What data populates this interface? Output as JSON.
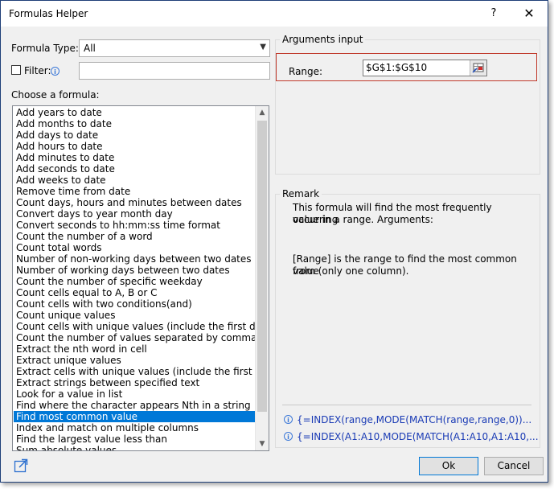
{
  "window": {
    "title": "Formulas Helper",
    "help_glyph": "?",
    "close_glyph": "✕"
  },
  "left": {
    "formula_type_label": "Formula Type:",
    "formula_type_value": "All",
    "filter_label": "Filter:",
    "filter_value": "",
    "choose_label": "Choose a formula:",
    "formulas": [
      "Add years to date",
      "Add months to date",
      "Add days to date",
      "Add hours to date",
      "Add minutes to date",
      "Add seconds to date",
      "Add weeks to date",
      "Remove time from date",
      "Count days, hours and minutes between dates",
      "Convert days to year month day",
      "Convert seconds to hh:mm:ss time format",
      "Count the number of a word",
      "Count total words",
      "Number of non-working days between two dates",
      "Number of working days between two dates",
      "Count the number of specific weekday",
      "Count cells equal to A, B or C",
      "Count cells with two conditions(and)",
      "Count unique values",
      "Count cells with unique values (include the first duplica",
      "Count the number of values separated by comma",
      "Extract the nth word in cell",
      "Extract unique values",
      "Extract cells with unique values (include the first duplic",
      "Extract strings between specified text",
      "Look for a value in list",
      "Find where the character appears Nth in a string",
      "Find most common value",
      "Index and match on multiple columns",
      "Find the largest value less than",
      "Sum absolute values"
    ],
    "selected_index": 27
  },
  "arguments": {
    "title": "Arguments input",
    "range_label": "Range:",
    "range_value": "$G$1:$G$10"
  },
  "remark": {
    "title": "Remark",
    "line1": "This formula will find the most frequently occurring",
    "line2": "value in a range. Arguments:",
    "line3": "[Range] is the range to find the most common value",
    "line4": "from (only one column).",
    "formula1": "{=INDEX(range,MODE(MATCH(range,range,0))...",
    "formula2": "{=INDEX(A1:A10,MODE(MATCH(A1:A10,A1:A10,..."
  },
  "buttons": {
    "ok": "Ok",
    "cancel": "Cancel"
  },
  "colors": {
    "selection": "#0078d7",
    "accent_border": "#c0392b",
    "formula_text": "#1a3bb5"
  }
}
